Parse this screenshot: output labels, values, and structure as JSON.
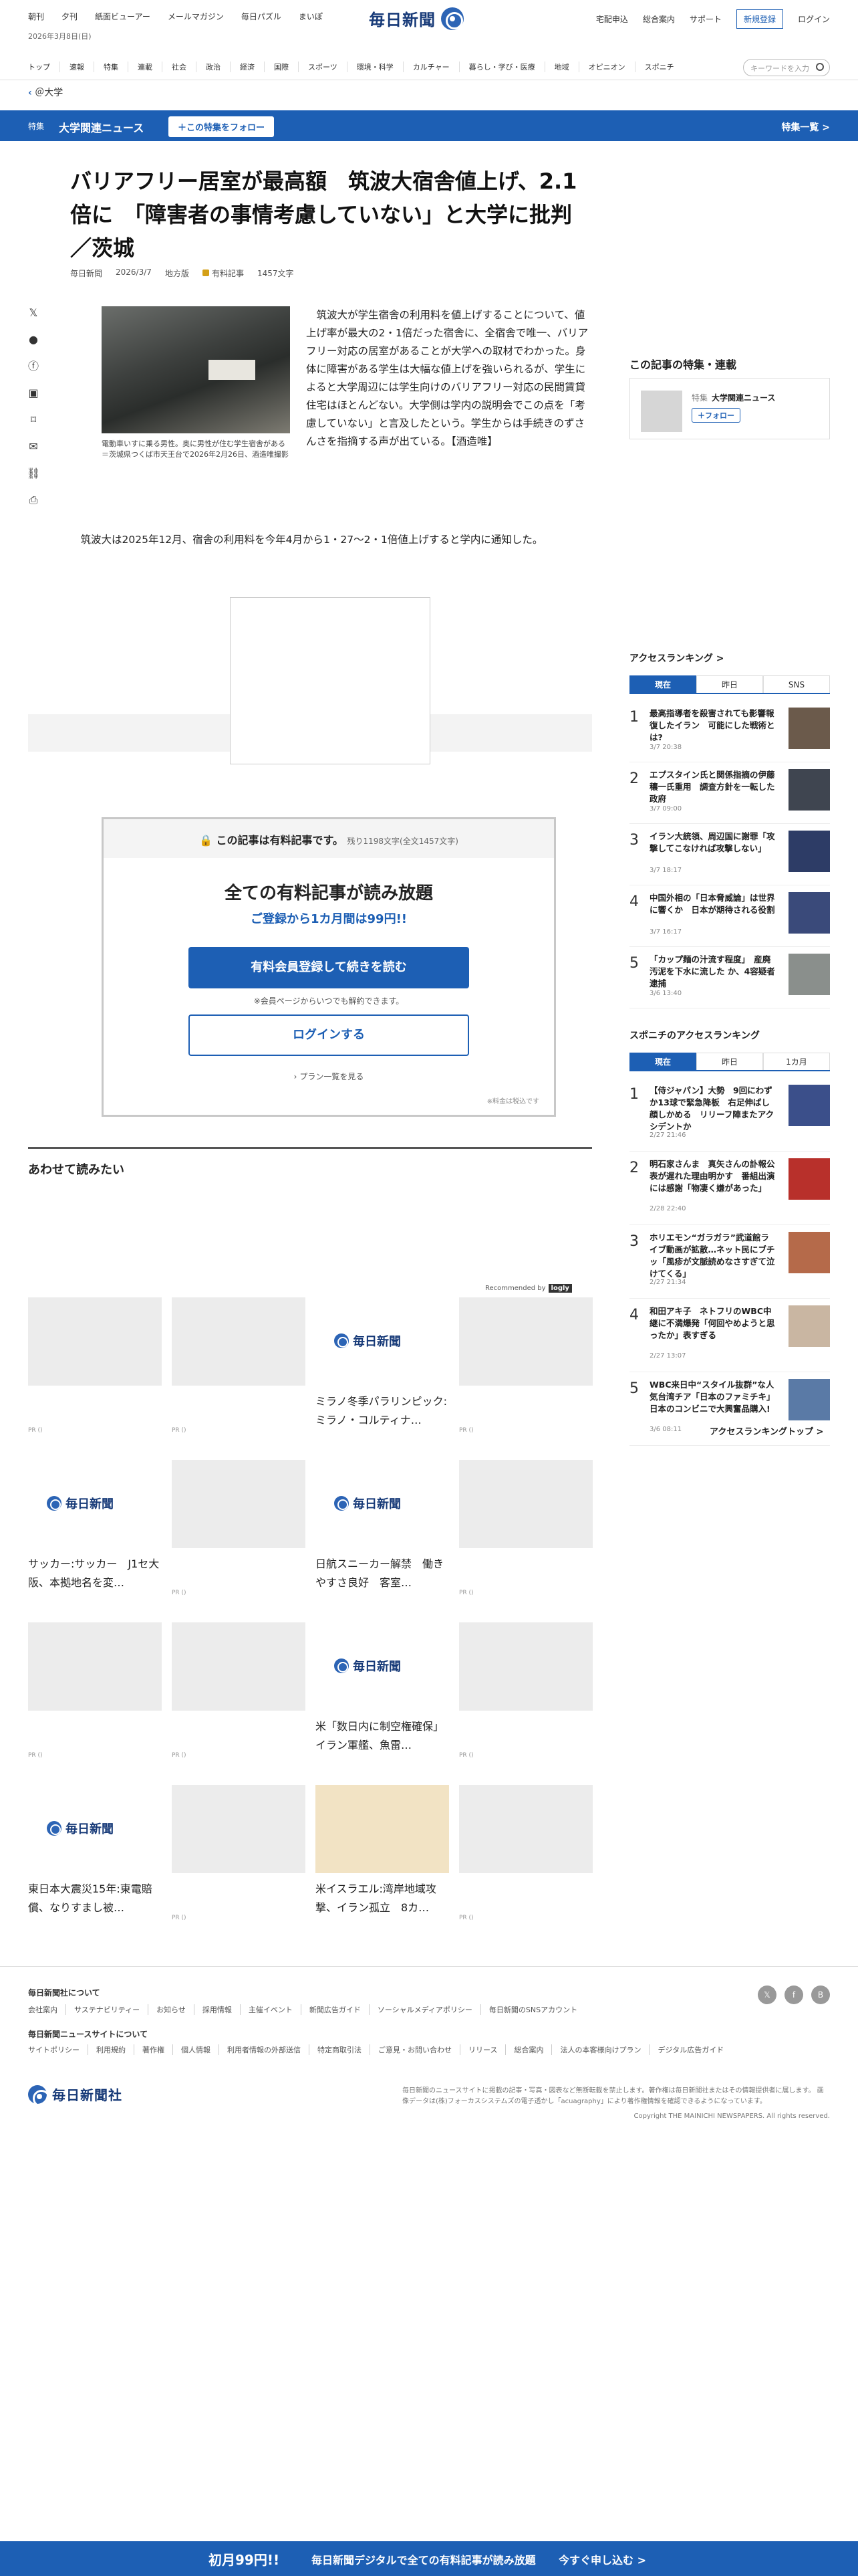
{
  "topnav": {
    "links": [
      "朝刊",
      "夕刊",
      "紙面ビューアー",
      "メールマガジン",
      "毎日パズル",
      "まいぽ"
    ],
    "date": "2026年3月8日(日)",
    "logo": "毎日新聞",
    "right_links": [
      "宅配申込",
      "総合案内",
      "サポート"
    ],
    "register": "新規登録",
    "login": "ログイン"
  },
  "catnav": {
    "items": [
      "トップ",
      "速報",
      "特集",
      "連載",
      "社会",
      "政治",
      "経済",
      "国際",
      "スポーツ",
      "環境・科学",
      "カルチャー",
      "暮らし・学び・医療",
      "地域",
      "オピニオン",
      "スポニチ"
    ],
    "search_placeholder": "キーワードを入力"
  },
  "breadcrumb": {
    "label": "＠大学"
  },
  "topic_bar": {
    "label": "特集",
    "name": "大学関連ニュース",
    "follow": "＋この特集をフォロー",
    "more": "特集一覧 >"
  },
  "article": {
    "title": "バリアフリー居室が最高額　筑波大宿舎値上げ、2.1倍に　「障害者の事情考慮していない」と大学に批判　／茨城",
    "meta": [
      "毎日新聞",
      "2026/3/7",
      "地方版",
      "有料記事",
      "1457文字"
    ],
    "caption": "電動車いすに乗る男性。奥に男性が住む学生宿舎がある＝茨城県つくば市天王台で2026年2月26日、酒造唯撮影",
    "lead": "筑波大が学生宿舎の利用料を値上げすることについて、値上げ率が最大の2・1倍だった宿舎に、全宿舎で唯一、バリアフリー対応の居室があることが大学への取材でわかった。身体に障害がある学生は大幅な値上げを強いられるが、学生によると大学周辺には学生向けのバリアフリー対応の民間賃貸住宅はほとんどない。大学側は学内の説明会でこの点を「考慮していない」と言及したという。学生からは手続きのずさんさを指摘する声が出ている。【酒造唯】",
    "para2": "筑波大は2025年12月、宿舎の利用料を今年4月から1・27～2・1倍値上げすると学内に通知した。"
  },
  "paywall": {
    "head": "この記事は有料記事です。",
    "remaining": "残り1198文字(全文1457文字)",
    "headline": "全ての有料記事が読み放題",
    "sub": "ご登録から1カ月間は99円!!",
    "cta": "有料会員登録して続きを読む",
    "note": "※会員ページからいつでも解約できます。",
    "login": "ログインする",
    "plans": "プラン一覧を見る",
    "tax": "※料金は税込です"
  },
  "related": {
    "heading": "あわせて読みたい",
    "recommended_by": "Recommended by",
    "recommended_brand": "logly",
    "pr": "PR ()",
    "cards": [
      {
        "title": "",
        "type": "blank",
        "pr": true
      },
      {
        "title": "",
        "type": "blank",
        "pr": true
      },
      {
        "title": "ミラノ冬季パラリンピック:ミラノ・コルティナ…",
        "type": "logo",
        "pr": false
      },
      {
        "title": "",
        "type": "blank",
        "pr": true
      },
      {
        "title": "サッカー:サッカー　J1セ大阪、本拠地名を変…",
        "type": "logo",
        "pr": false
      },
      {
        "title": "",
        "type": "blank",
        "pr": true
      },
      {
        "title": "日航スニーカー解禁　働きやすさ良好　客室…",
        "type": "logo",
        "pr": false
      },
      {
        "title": "",
        "type": "blank",
        "pr": true
      },
      {
        "title": "",
        "type": "blank",
        "pr": true
      },
      {
        "title": "",
        "type": "blank",
        "pr": true
      },
      {
        "title": "米「数日内に制空権確保」　イラン軍艦、魚雷…",
        "type": "logo",
        "pr": false
      },
      {
        "title": "",
        "type": "blank",
        "pr": true
      },
      {
        "title": "東日本大震災15年:東電賠償、なりすまし被…",
        "type": "logo",
        "pr": false
      },
      {
        "title": "",
        "type": "blank",
        "pr": true
      },
      {
        "title": "米イスラエル:湾岸地域攻撃、イラン孤立　8カ…",
        "type": "map",
        "pr": false
      },
      {
        "title": "",
        "type": "blank",
        "pr": true
      }
    ]
  },
  "sidebar": {
    "feature_heading": "この記事の特集・連載",
    "feature_label": "特集",
    "feature_name": "大学関連ニュース",
    "feature_follow": "＋フォロー",
    "ranking_heading": "アクセスランキング >",
    "ranking_tabs": [
      "現在",
      "昨日",
      "SNS"
    ],
    "ranking": [
      {
        "num": "1",
        "title": "最高指導者を殺害されても影響報復したイラン　可能にした戦術とは?",
        "date": "3/7 20:38"
      },
      {
        "num": "2",
        "title": "エプスタイン氏と関係指摘の伊藤穰一氏重用　調査方針を一転した政府",
        "date": "3/7 09:00"
      },
      {
        "num": "3",
        "title": "イラン大統領、周辺国に謝罪「攻撃してこなければ攻撃しない」",
        "date": "3/7 18:17"
      },
      {
        "num": "4",
        "title": "中国外相の「日本脅威論」は世界に響くか　日本が期待される役割",
        "date": "3/7 16:17"
      },
      {
        "num": "5",
        "title": "「カップ麺の汁流す程度」　産廃汚泥を下水に流した か、4容疑者逮捕",
        "date": "3/6 13:40"
      }
    ],
    "spo_heading": "スポニチのアクセスランキング",
    "spo_tabs": [
      "現在",
      "昨日",
      "1カ月"
    ],
    "spo_ranking": [
      {
        "num": "1",
        "title": "【侍ジャパン】大勢　9回にわずか13球で緊急降板　右足伸ばし顔しかめる　リリーフ陣またアクシデントか",
        "date": "2/27 21:46"
      },
      {
        "num": "2",
        "title": "明石家さんま　真矢さんの訃報公表が遅れた理由明かす　番組出演には感謝「物凄く嫌があった」",
        "date": "2/28 22:40"
      },
      {
        "num": "3",
        "title": "ホリエモン“ガラガラ”武道館ライブ動画が拡散…ネット民にブチッ「風疹が文脈読めなさすぎて泣けてくる」",
        "date": "2/27 21:34"
      },
      {
        "num": "4",
        "title": "和田アキ子　ネトフリのWBC中継に不満爆発「何回やめようと思ったか」表すぎる",
        "date": "2/27 13:07"
      },
      {
        "num": "5",
        "title": "WBC来日中“スタイル抜群”な人気台湾チア「日本のファミチキ」日本のコンビニで大興奮品購入!",
        "date": "3/6 08:11"
      }
    ],
    "ranking_more": "アクセスランキングトップ >"
  },
  "footer": {
    "about_heading": "毎日新聞社について",
    "about_links": [
      "会社案内",
      "サステナビリティー",
      "お知らせ",
      "採用情報",
      "主催イベント",
      "新聞広告ガイド",
      "ソーシャルメディアポリシー",
      "毎日新聞のSNSアカウント"
    ],
    "site_heading": "毎日新聞ニュースサイトについて",
    "site_links": [
      "サイトポリシー",
      "利用規約",
      "著作権",
      "個人情報",
      "利用者情報の外部送信",
      "特定商取引法",
      "ご意見・お問い合わせ",
      "リリース",
      "総合案内",
      "法人の本客様向けプラン",
      "デジタル広告ガイド"
    ],
    "company": "毎日新聞社",
    "disclaimer": "毎日新聞のニュースサイトに掲載の記事・写真・図表など無断転載を禁止します。著作権は毎日新聞社またはその情報提供者に属します。 画像データは(株)フォーカスシステムズの電子透かし「acuagraphy」により著作権情報を確認できるようになっています。",
    "copyright": "Copyright THE MAINICHI NEWSPAPERS. All rights reserved."
  },
  "bottombar": {
    "price": "初月99円!!",
    "msg": "毎日新聞デジタルで全ての有料記事が読み放題",
    "cta": "今すぐ申し込む >"
  },
  "colors": {
    "brand": "#1d5fb4",
    "logo": "#173a78"
  }
}
